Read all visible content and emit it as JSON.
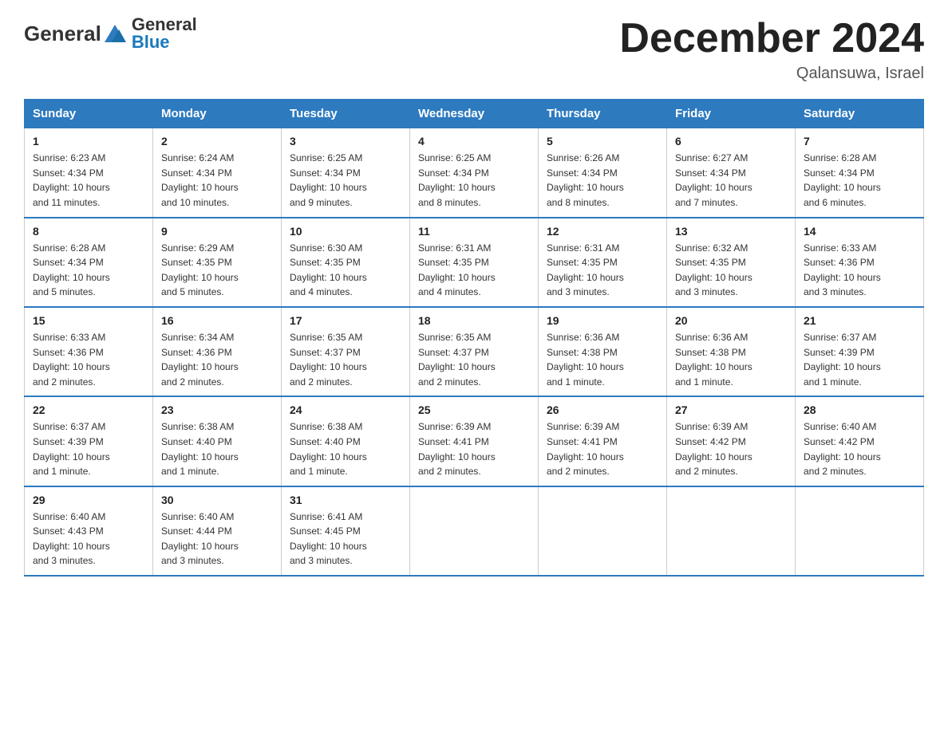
{
  "header": {
    "logo_general": "General",
    "logo_blue": "Blue",
    "title": "December 2024",
    "subtitle": "Qalansuwa, Israel"
  },
  "days_of_week": [
    "Sunday",
    "Monday",
    "Tuesday",
    "Wednesday",
    "Thursday",
    "Friday",
    "Saturday"
  ],
  "weeks": [
    [
      {
        "day": "1",
        "sunrise": "6:23 AM",
        "sunset": "4:34 PM",
        "daylight": "10 hours and 11 minutes."
      },
      {
        "day": "2",
        "sunrise": "6:24 AM",
        "sunset": "4:34 PM",
        "daylight": "10 hours and 10 minutes."
      },
      {
        "day": "3",
        "sunrise": "6:25 AM",
        "sunset": "4:34 PM",
        "daylight": "10 hours and 9 minutes."
      },
      {
        "day": "4",
        "sunrise": "6:25 AM",
        "sunset": "4:34 PM",
        "daylight": "10 hours and 8 minutes."
      },
      {
        "day": "5",
        "sunrise": "6:26 AM",
        "sunset": "4:34 PM",
        "daylight": "10 hours and 8 minutes."
      },
      {
        "day": "6",
        "sunrise": "6:27 AM",
        "sunset": "4:34 PM",
        "daylight": "10 hours and 7 minutes."
      },
      {
        "day": "7",
        "sunrise": "6:28 AM",
        "sunset": "4:34 PM",
        "daylight": "10 hours and 6 minutes."
      }
    ],
    [
      {
        "day": "8",
        "sunrise": "6:28 AM",
        "sunset": "4:34 PM",
        "daylight": "10 hours and 5 minutes."
      },
      {
        "day": "9",
        "sunrise": "6:29 AM",
        "sunset": "4:35 PM",
        "daylight": "10 hours and 5 minutes."
      },
      {
        "day": "10",
        "sunrise": "6:30 AM",
        "sunset": "4:35 PM",
        "daylight": "10 hours and 4 minutes."
      },
      {
        "day": "11",
        "sunrise": "6:31 AM",
        "sunset": "4:35 PM",
        "daylight": "10 hours and 4 minutes."
      },
      {
        "day": "12",
        "sunrise": "6:31 AM",
        "sunset": "4:35 PM",
        "daylight": "10 hours and 3 minutes."
      },
      {
        "day": "13",
        "sunrise": "6:32 AM",
        "sunset": "4:35 PM",
        "daylight": "10 hours and 3 minutes."
      },
      {
        "day": "14",
        "sunrise": "6:33 AM",
        "sunset": "4:36 PM",
        "daylight": "10 hours and 3 minutes."
      }
    ],
    [
      {
        "day": "15",
        "sunrise": "6:33 AM",
        "sunset": "4:36 PM",
        "daylight": "10 hours and 2 minutes."
      },
      {
        "day": "16",
        "sunrise": "6:34 AM",
        "sunset": "4:36 PM",
        "daylight": "10 hours and 2 minutes."
      },
      {
        "day": "17",
        "sunrise": "6:35 AM",
        "sunset": "4:37 PM",
        "daylight": "10 hours and 2 minutes."
      },
      {
        "day": "18",
        "sunrise": "6:35 AM",
        "sunset": "4:37 PM",
        "daylight": "10 hours and 2 minutes."
      },
      {
        "day": "19",
        "sunrise": "6:36 AM",
        "sunset": "4:38 PM",
        "daylight": "10 hours and 1 minute."
      },
      {
        "day": "20",
        "sunrise": "6:36 AM",
        "sunset": "4:38 PM",
        "daylight": "10 hours and 1 minute."
      },
      {
        "day": "21",
        "sunrise": "6:37 AM",
        "sunset": "4:39 PM",
        "daylight": "10 hours and 1 minute."
      }
    ],
    [
      {
        "day": "22",
        "sunrise": "6:37 AM",
        "sunset": "4:39 PM",
        "daylight": "10 hours and 1 minute."
      },
      {
        "day": "23",
        "sunrise": "6:38 AM",
        "sunset": "4:40 PM",
        "daylight": "10 hours and 1 minute."
      },
      {
        "day": "24",
        "sunrise": "6:38 AM",
        "sunset": "4:40 PM",
        "daylight": "10 hours and 1 minute."
      },
      {
        "day": "25",
        "sunrise": "6:39 AM",
        "sunset": "4:41 PM",
        "daylight": "10 hours and 2 minutes."
      },
      {
        "day": "26",
        "sunrise": "6:39 AM",
        "sunset": "4:41 PM",
        "daylight": "10 hours and 2 minutes."
      },
      {
        "day": "27",
        "sunrise": "6:39 AM",
        "sunset": "4:42 PM",
        "daylight": "10 hours and 2 minutes."
      },
      {
        "day": "28",
        "sunrise": "6:40 AM",
        "sunset": "4:42 PM",
        "daylight": "10 hours and 2 minutes."
      }
    ],
    [
      {
        "day": "29",
        "sunrise": "6:40 AM",
        "sunset": "4:43 PM",
        "daylight": "10 hours and 3 minutes."
      },
      {
        "day": "30",
        "sunrise": "6:40 AM",
        "sunset": "4:44 PM",
        "daylight": "10 hours and 3 minutes."
      },
      {
        "day": "31",
        "sunrise": "6:41 AM",
        "sunset": "4:45 PM",
        "daylight": "10 hours and 3 minutes."
      },
      null,
      null,
      null,
      null
    ]
  ],
  "labels": {
    "sunrise": "Sunrise:",
    "sunset": "Sunset:",
    "daylight": "Daylight:"
  },
  "colors": {
    "header_bg": "#2d7abf",
    "logo_blue": "#1a7abf",
    "border_accent": "#2d7abf"
  }
}
